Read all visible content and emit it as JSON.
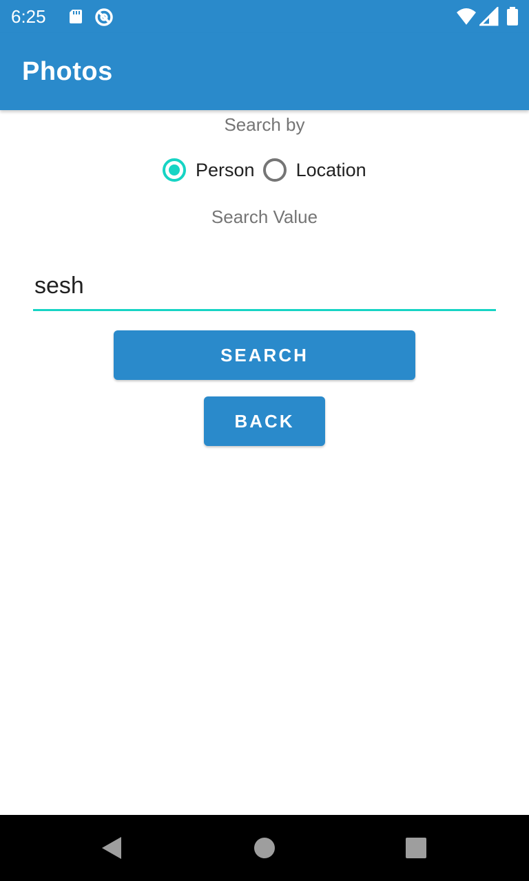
{
  "status_bar": {
    "time": "6:25",
    "icons": [
      "sd-card-icon",
      "sync-icon",
      "wifi-icon",
      "signal-icon",
      "battery-icon"
    ]
  },
  "app_bar": {
    "title": "Photos"
  },
  "search_form": {
    "search_by_label": "Search by",
    "radio_options": [
      {
        "label": "Person",
        "checked": true
      },
      {
        "label": "Location",
        "checked": false
      }
    ],
    "search_value_label": "Search Value",
    "search_value": "sesh",
    "search_button_label": "SEARCH",
    "back_button_label": "BACK"
  },
  "nav_bar": {
    "buttons": [
      "back-nav-icon",
      "home-nav-icon",
      "recents-nav-icon"
    ]
  },
  "colors": {
    "primary": "#2a8acb",
    "accent": "#16d4c4",
    "secondary_text": "#757575",
    "primary_text": "#212121"
  }
}
